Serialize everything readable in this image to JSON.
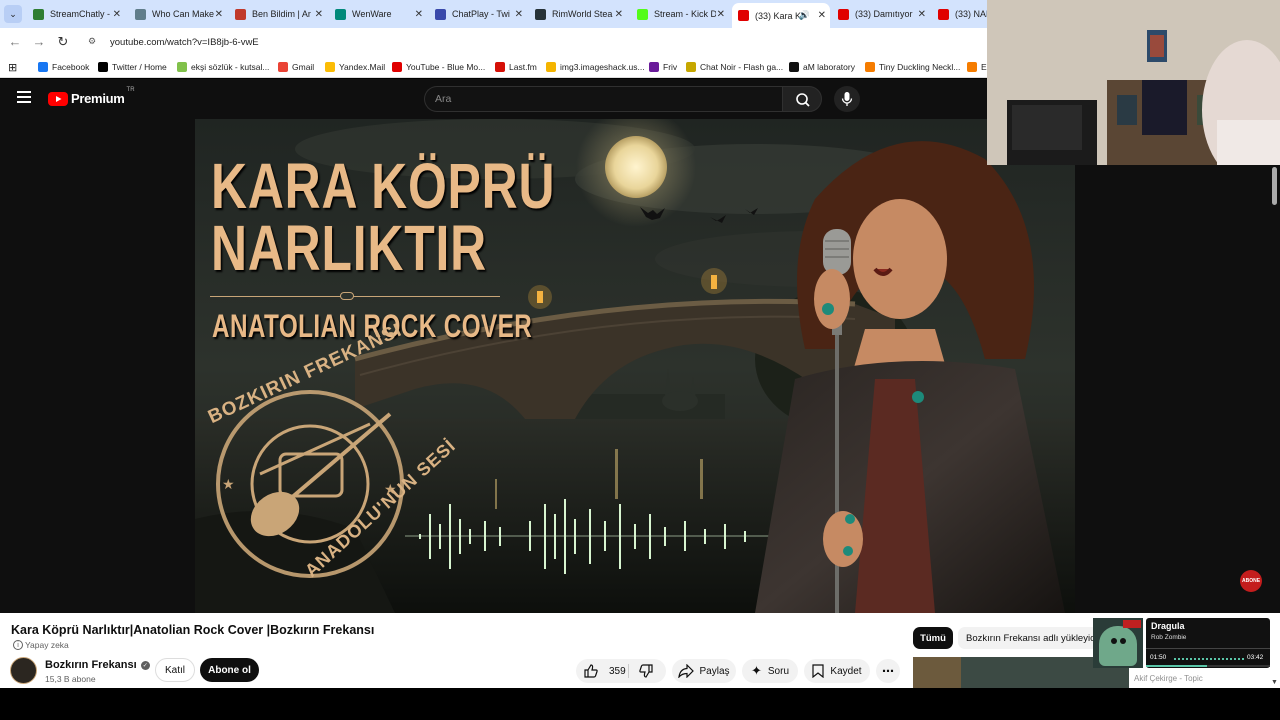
{
  "tabs": [
    {
      "label": "StreamChatly -",
      "color": "#2e7d32"
    },
    {
      "label": "Who Can Make",
      "color": "#607d8b"
    },
    {
      "label": "Ben Bildim | Ar",
      "color": "#c0392b"
    },
    {
      "label": "WenWare",
      "color": "#00897b"
    },
    {
      "label": "ChatPlay - Twi",
      "color": "#3949ab"
    },
    {
      "label": "RimWorld Stea",
      "color": "#263238"
    },
    {
      "label": "Stream - Kick D",
      "color": "#53fc18"
    },
    {
      "label": "(33) Kara K",
      "color": "#e00000",
      "active": true
    },
    {
      "label": "(33) Damıtıyor",
      "color": "#e00000"
    },
    {
      "label": "(33) NAP",
      "color": "#e00000"
    }
  ],
  "tabstrip": {
    "list_icon": "chevron-down-icon"
  },
  "toolbar": {
    "url": "youtube.com/watch?v=IB8jb-6-vwE"
  },
  "bookmarks": [
    {
      "label": "Facebook",
      "color": "#1877f2"
    },
    {
      "label": "Twitter / Home",
      "color": "#000000"
    },
    {
      "label": "ekşi sözlük - kutsal...",
      "color": "#81c14b"
    },
    {
      "label": "Gmail",
      "color": "#ea4335"
    },
    {
      "label": "Yandex.Mail",
      "color": "#fbbc05"
    },
    {
      "label": "YouTube - Blue Mo...",
      "color": "#e00000"
    },
    {
      "label": "Last.fm",
      "color": "#d51007"
    },
    {
      "label": "img3.imageshack.us...",
      "color": "#f4b400"
    },
    {
      "label": "Friv",
      "color": "#6a1b9a"
    },
    {
      "label": "Chat Noir - Flash ga...",
      "color": "#c6a700"
    },
    {
      "label": "aM laboratory",
      "color": "#111111"
    },
    {
      "label": "Tiny Duckling Neckl...",
      "color": "#f57c00"
    },
    {
      "label": "E",
      "color": "#f57c00"
    }
  ],
  "youtube": {
    "logo": "Premium",
    "region": "TR",
    "search_placeholder": "Ara",
    "video": {
      "art_title_line1": "KARA KÖPRÜ",
      "art_title_line2": "NARLIKTIR",
      "art_subtitle": "ANATOLIAN ROCK COVER",
      "seal_top": "BOZKIRIN FREKANSI",
      "seal_bottom": "ANADOLU'NUN SESİ",
      "corner_badge": "ABONE"
    },
    "title": "Kara Köprü Narlıktır|Anatolian Rock Cover |Bozkırın Frekansı",
    "ai_label": "Yapay zeka",
    "channel": {
      "name": "Bozkırın Frekansı",
      "subs": "15,3 B abone"
    },
    "buttons": {
      "join": "Katıl",
      "subscribe": "Abone ol",
      "likes": "359",
      "share": "Paylaş",
      "ask": "Soru",
      "save": "Kaydet"
    },
    "filters": {
      "all": "Tümü",
      "uploader": "Bozkırın Frekansı adlı yükleyici"
    },
    "up_next_channel": "Akif Çekirge - Topic"
  },
  "mini_player": {
    "song": "Dragula",
    "artist": "Rob Zombie",
    "elapsed": "01:50",
    "duration": "03:42",
    "progress": 0.495
  }
}
